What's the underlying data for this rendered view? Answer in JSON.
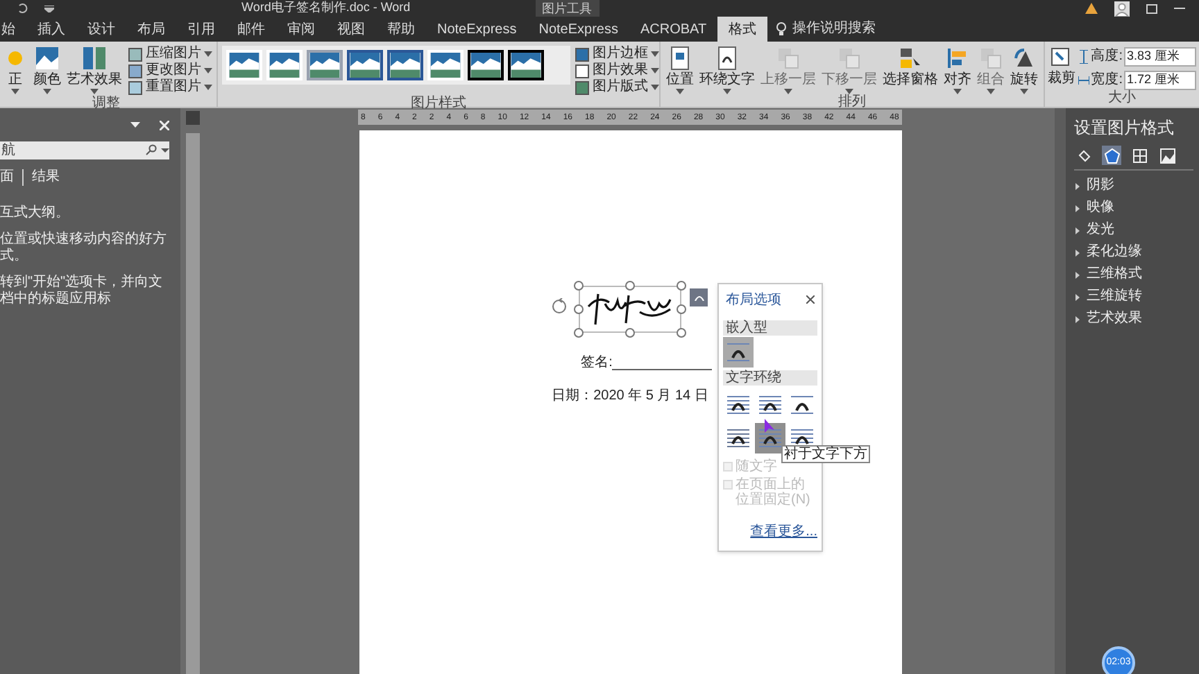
{
  "title_bar": {
    "title": "Word电子签名制作.doc  -  Word",
    "context_tab": "图片工具"
  },
  "tabs": [
    {
      "label": "始",
      "selected": false
    },
    {
      "label": "插入",
      "selected": false
    },
    {
      "label": "设计",
      "selected": false
    },
    {
      "label": "布局",
      "selected": false
    },
    {
      "label": "引用",
      "selected": false
    },
    {
      "label": "邮件",
      "selected": false
    },
    {
      "label": "审阅",
      "selected": false
    },
    {
      "label": "视图",
      "selected": false
    },
    {
      "label": "帮助",
      "selected": false
    },
    {
      "label": "NoteExpress",
      "selected": false
    },
    {
      "label": "NoteExpress",
      "selected": false
    },
    {
      "label": "ACROBAT",
      "selected": false
    },
    {
      "label": "格式",
      "selected": true
    }
  ],
  "tell_me": "操作说明搜索",
  "ribbon": {
    "adjust": {
      "label": "调整",
      "large": [
        {
          "label": "正",
          "disabled": false
        },
        {
          "label": "颜色",
          "disabled": false
        },
        {
          "label": "艺术效果",
          "disabled": false
        }
      ],
      "small": [
        {
          "label": "压缩图片",
          "disabled": false
        },
        {
          "label": "更改图片",
          "disabled": false
        },
        {
          "label": "重置图片",
          "disabled": false
        }
      ]
    },
    "styles": {
      "label": "图片样式",
      "small": [
        {
          "label": "图片边框",
          "disabled": false
        },
        {
          "label": "图片效果",
          "disabled": false
        },
        {
          "label": "图片版式",
          "disabled": false
        }
      ]
    },
    "arrange": {
      "label": "排列",
      "large": [
        {
          "label": "位置",
          "disabled": false
        },
        {
          "label": "环绕文字",
          "disabled": false
        },
        {
          "label": "上移一层",
          "disabled": true
        },
        {
          "label": "下移一层",
          "disabled": true
        },
        {
          "label": "选择窗格",
          "disabled": false
        },
        {
          "label": "对齐",
          "disabled": false
        },
        {
          "label": "组合",
          "disabled": true
        },
        {
          "label": "旋转",
          "disabled": false
        }
      ]
    },
    "size": {
      "label": "大小",
      "crop": "裁剪",
      "fields": [
        {
          "label": "高度:",
          "value": "3.83 厘米"
        },
        {
          "label": "宽度:",
          "value": "1.72 厘米"
        }
      ]
    }
  },
  "nav_pane": {
    "search": {
      "placeholder": "航"
    },
    "tabs": [
      {
        "label": "面",
        "selected": false
      },
      {
        "label": "结果",
        "selected": false
      }
    ],
    "paragraphs": [
      "互式大纲。",
      "位置或快速移动内容的好方式。",
      "转到\"开始\"选项卡，并向文档中的标题应用标"
    ]
  },
  "ruler": [
    "8",
    "6",
    "4",
    "2",
    "2",
    "4",
    "6",
    "8",
    "10",
    "12",
    "14",
    "16",
    "18",
    "20",
    "22",
    "24",
    "26",
    "28",
    "30",
    "32",
    "34",
    "36",
    "38",
    "42",
    "44",
    "46",
    "48"
  ],
  "document": {
    "signature_label": "签名:",
    "date_line": "日期：2020 年 5 月 14 日"
  },
  "layout_options": {
    "title": "布局选项",
    "inline_heading": "嵌入型",
    "inline_options": [
      {
        "selected": true
      }
    ],
    "wrap_heading": "文字环绕",
    "wrap_options": [
      {
        "selected": false,
        "hovered": false
      },
      {
        "selected": false,
        "hovered": false
      },
      {
        "selected": false,
        "hovered": false
      },
      {
        "selected": false,
        "hovered": false
      },
      {
        "selected": false,
        "hovered": true
      },
      {
        "selected": false,
        "hovered": false
      }
    ],
    "tooltip": "衬于文字下方",
    "checkboxes": [
      {
        "label": "随文字",
        "checked": false,
        "disabled": true
      },
      {
        "label": "在页面上的位置固定(N)",
        "checked": false,
        "disabled": true
      }
    ],
    "link": "查看更多..."
  },
  "format_pane": {
    "title": "设置图片格式",
    "icon_tabs": [
      {
        "selected": false
      },
      {
        "selected": true
      },
      {
        "selected": false
      },
      {
        "selected": false
      }
    ],
    "sections": [
      {
        "label": "阴影",
        "expanded": false
      },
      {
        "label": "映像",
        "expanded": false
      },
      {
        "label": "发光",
        "expanded": false
      },
      {
        "label": "柔化边缘",
        "expanded": false
      },
      {
        "label": "三维格式",
        "expanded": false
      },
      {
        "label": "三维旋转",
        "expanded": false
      },
      {
        "label": "艺术效果",
        "expanded": false
      }
    ]
  },
  "timer": "02:03"
}
